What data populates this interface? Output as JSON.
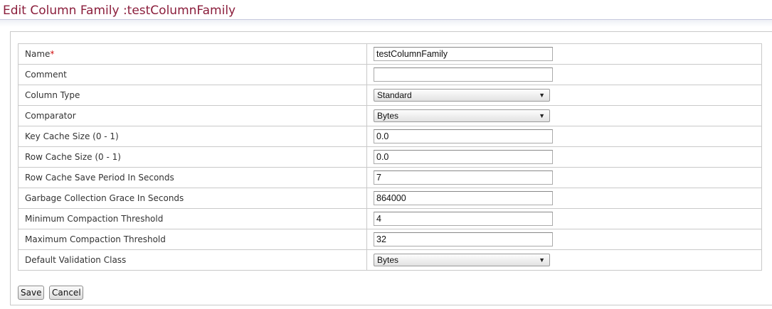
{
  "page": {
    "title": "Edit Column Family :testColumnFamily"
  },
  "form": {
    "required_marker": "*",
    "rows": [
      {
        "label": "Name",
        "type": "text",
        "value": "testColumnFamily",
        "required": true
      },
      {
        "label": "Comment",
        "type": "text",
        "value": ""
      },
      {
        "label": "Column Type",
        "type": "select",
        "value": "Standard"
      },
      {
        "label": "Comparator",
        "type": "select",
        "value": "Bytes"
      },
      {
        "label": "Key Cache Size (0 - 1)",
        "type": "text",
        "value": "0.0"
      },
      {
        "label": "Row Cache Size (0 - 1)",
        "type": "text",
        "value": "0.0"
      },
      {
        "label": "Row Cache Save Period In Seconds",
        "type": "text",
        "value": "7"
      },
      {
        "label": "Garbage Collection Grace In Seconds",
        "type": "text",
        "value": "864000"
      },
      {
        "label": "Minimum Compaction Threshold",
        "type": "text",
        "value": "4"
      },
      {
        "label": "Maximum Compaction Threshold",
        "type": "text",
        "value": "32"
      },
      {
        "label": "Default Validation Class",
        "type": "select",
        "value": "Bytes"
      }
    ]
  },
  "buttons": {
    "save": "Save",
    "cancel": "Cancel"
  },
  "colors": {
    "title": "#8b1e3c",
    "required": "#d01010",
    "border": "#c9c9c9"
  },
  "icons": {
    "dropdown": "triangle-down"
  }
}
